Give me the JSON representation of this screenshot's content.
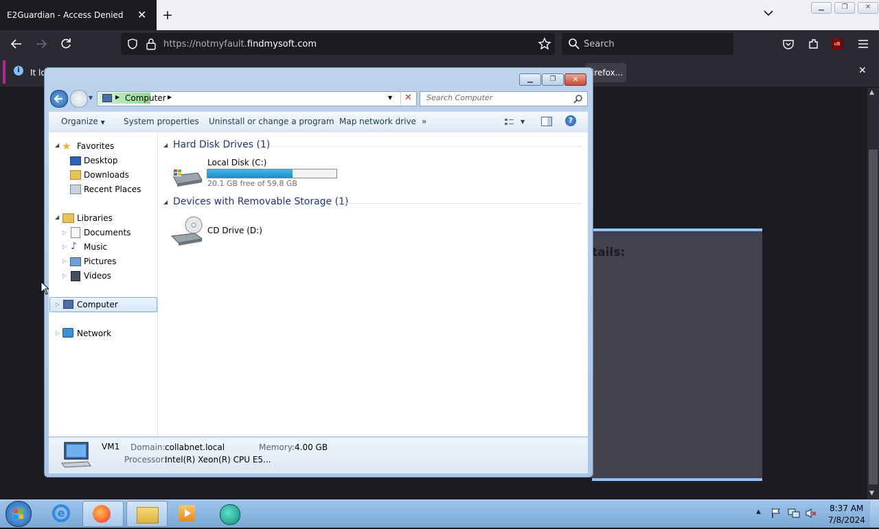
{
  "browser": {
    "tab_title": "E2Guardian - Access Denied",
    "tab_close": "✕",
    "new_tab": "+",
    "tab_list": "⌄",
    "url_host_prefix": "https://notmyfault.",
    "url_host_main": "findmysoft.com",
    "search_placeholder": "Search",
    "notification_left": "It lo",
    "notification_right": "irefox...",
    "notification_close": "✕",
    "page_heading": "tails:",
    "extension_badge": "uB"
  },
  "explorer": {
    "address_path": "Computer",
    "search_placeholder": "Search Computer",
    "commands": [
      "Organize",
      "System properties",
      "Uninstall or change a program",
      "Map network drive",
      "»"
    ],
    "nav": {
      "favorites": "Favorites",
      "desktop": "Desktop",
      "downloads": "Downloads",
      "recent_places": "Recent Places",
      "libraries": "Libraries",
      "documents": "Documents",
      "music": "Music",
      "pictures": "Pictures",
      "videos": "Videos",
      "computer": "Computer",
      "network": "Network"
    },
    "groups": {
      "hard_disk": "Hard Disk Drives (1)",
      "removable": "Devices with Removable Storage (1)"
    },
    "drives": {
      "local_name": "Local Disk (C:)",
      "local_free": "20.1 GB free of 59.8 GB",
      "local_used_fraction": 0.66,
      "cd_name": "CD Drive (D:)"
    },
    "details": {
      "computer_name": "VM1",
      "domain_label": "Domain:",
      "domain_value": "collabnet.local",
      "memory_label": "Memory:",
      "memory_value": "4.00 GB",
      "processor_label": "Processor:",
      "processor_value": "Intel(R) Xeon(R) CPU E5..."
    }
  },
  "taskbar": {
    "time": "8:37 AM",
    "date": "7/8/2024"
  },
  "colors": {
    "browser_dark": "#1c1b22",
    "toolbar": "#2b2a33",
    "accent_blue": "#8ec5ff",
    "notification_accent": "#b3278f",
    "progress_fill": "#26a0da"
  }
}
